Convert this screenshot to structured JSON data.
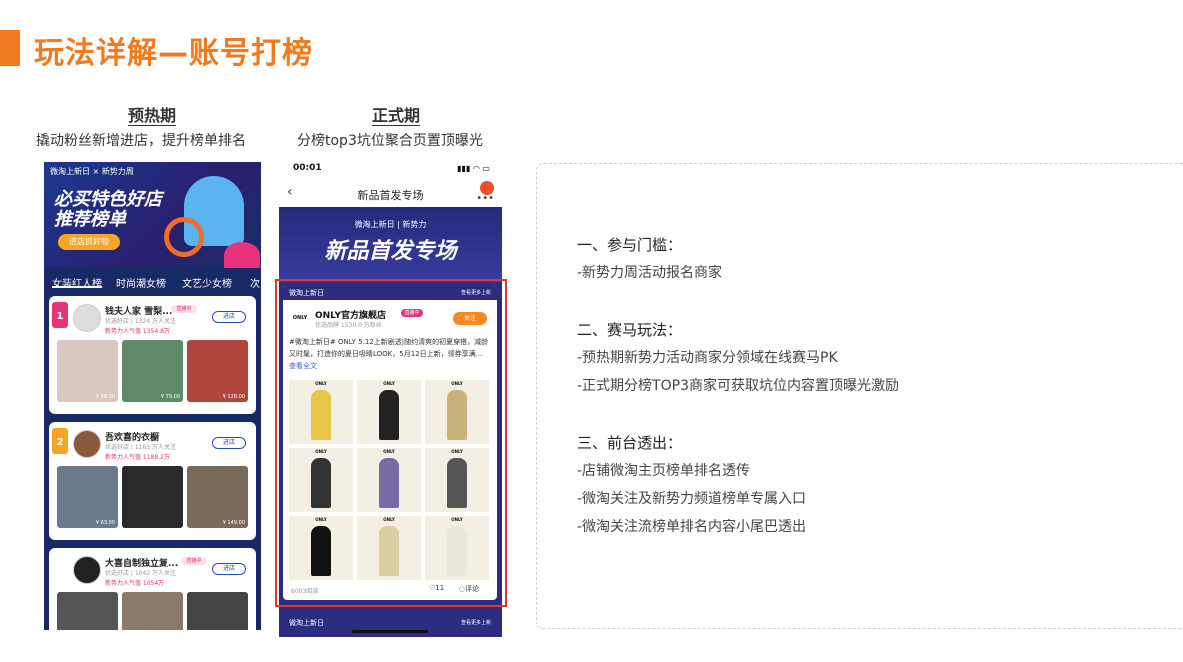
{
  "header": {
    "title": "玩法详解—账号打榜",
    "accent_color": "#f07a1e"
  },
  "preheat": {
    "title": "预热期",
    "desc": "撬动粉丝新增进店，提升榜单排名"
  },
  "official": {
    "title": "正式期",
    "desc": "分榜top3坑位聚合页置顶曝光"
  },
  "phone1": {
    "status": "微淘上新日 × 新势力周",
    "banner_line1": "必买特色好店",
    "banner_line2": "推荐榜单",
    "banner_button": "进店抓好物",
    "tabs": [
      "女装红人榜",
      "时尚潮女榜",
      "文艺少女榜",
      "次"
    ],
    "cards": [
      {
        "rank": "1",
        "name": "钱夫人家 雪梨...",
        "live": "直播中",
        "sub": "优选好店 | 1324 万人关注",
        "pop": "新势力人气值 1354.8万",
        "button": "进店",
        "prices": [
          "¥ 58.00",
          "¥ 79.00",
          "¥ 128.00"
        ]
      },
      {
        "rank": "2",
        "name": "吾欢喜的衣橱",
        "live": "",
        "sub": "优选好店 | 1163 万人关注",
        "pop": "新势力人气值 1188.2万",
        "button": "进店",
        "prices": [
          "¥ 63.00",
          "",
          "¥ 149.00"
        ]
      },
      {
        "rank": "",
        "name": "大喜自制独立复...",
        "live": "直播中",
        "sub": "优选好店 | 1042 万人关注",
        "pop": "新势力人气值 1054万",
        "button": "进店",
        "prices": [
          "",
          "",
          ""
        ]
      }
    ]
  },
  "phone2": {
    "time": "00:01",
    "nav_title": "新品首发专场",
    "brand_line": "微淘上新日 | 新势力",
    "big_title": "新品首发专场",
    "section_left": "微淘上新日",
    "section_right": "查看更多上新",
    "logo": "ONLY",
    "shop_name": "ONLY官方旗舰店",
    "live": "直播中",
    "shop_sub": "优选品牌  1530.0 万粉丝",
    "follow": "关注",
    "post_text": "#微淘上新日# ONLY 5.12上新剧透|随约清爽的初夏穿搭，减龄又时髦，打造你的夏日吸睛LOOK，5月12日上新，领券享满...",
    "post_link": "查看全文",
    "grid_label": "ONLY",
    "reads": "6003阅读",
    "likes": "11",
    "comment": "评论"
  },
  "panel": {
    "sections": [
      {
        "heading": "一、参与门槛：",
        "items": [
          "-新势力周活动报名商家"
        ]
      },
      {
        "heading": "二、赛马玩法：",
        "items": [
          "-预热期新势力活动商家分领域在线赛马PK",
          "-正式期分榜TOP3商家可获取坑位内容置顶曝光激励"
        ]
      },
      {
        "heading": "三、前台透出：",
        "items": [
          "-店铺微淘主页榜单排名透传",
          "-微淘关注及新势力频道榜单专属入口",
          "-微淘关注流榜单排名内容小尾巴透出"
        ]
      }
    ]
  }
}
